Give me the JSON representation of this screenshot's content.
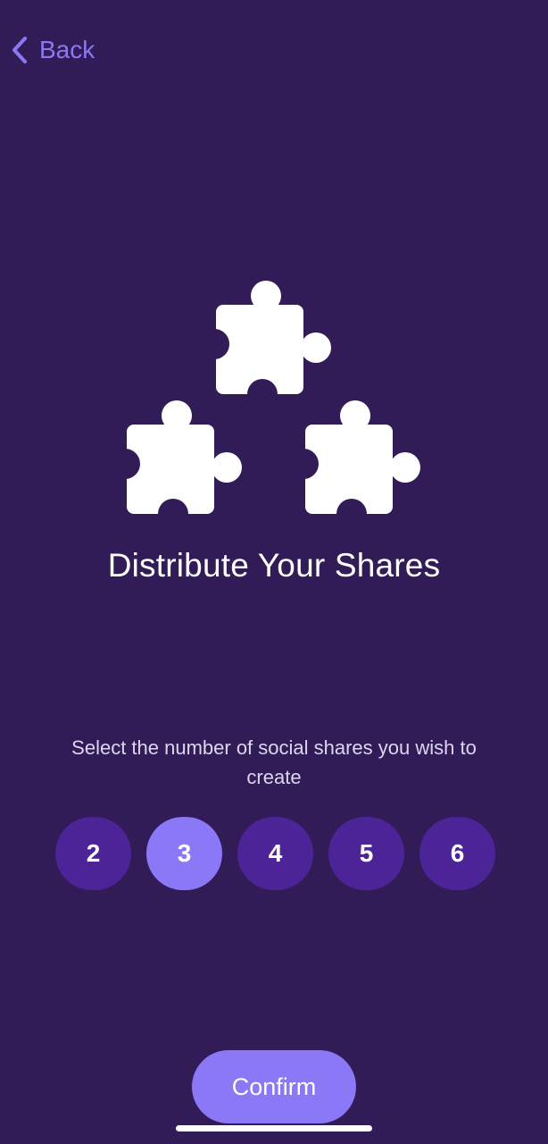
{
  "nav": {
    "back_label": "Back",
    "back_icon": "chevron-left-icon"
  },
  "hero": {
    "icons": [
      "puzzle-piece-icon",
      "puzzle-piece-icon",
      "puzzle-piece-icon"
    ]
  },
  "title": "Distribute Your Shares",
  "subtitle": "Select the number of social shares you wish to create",
  "share_options": [
    {
      "label": "2",
      "selected": false
    },
    {
      "label": "3",
      "selected": true
    },
    {
      "label": "4",
      "selected": false
    },
    {
      "label": "5",
      "selected": false
    },
    {
      "label": "6",
      "selected": false
    }
  ],
  "confirm_label": "Confirm",
  "colors": {
    "background": "#311c57",
    "accent": "#8a78f7",
    "option_bg": "#4d2398",
    "back_text": "#8b78f2"
  }
}
